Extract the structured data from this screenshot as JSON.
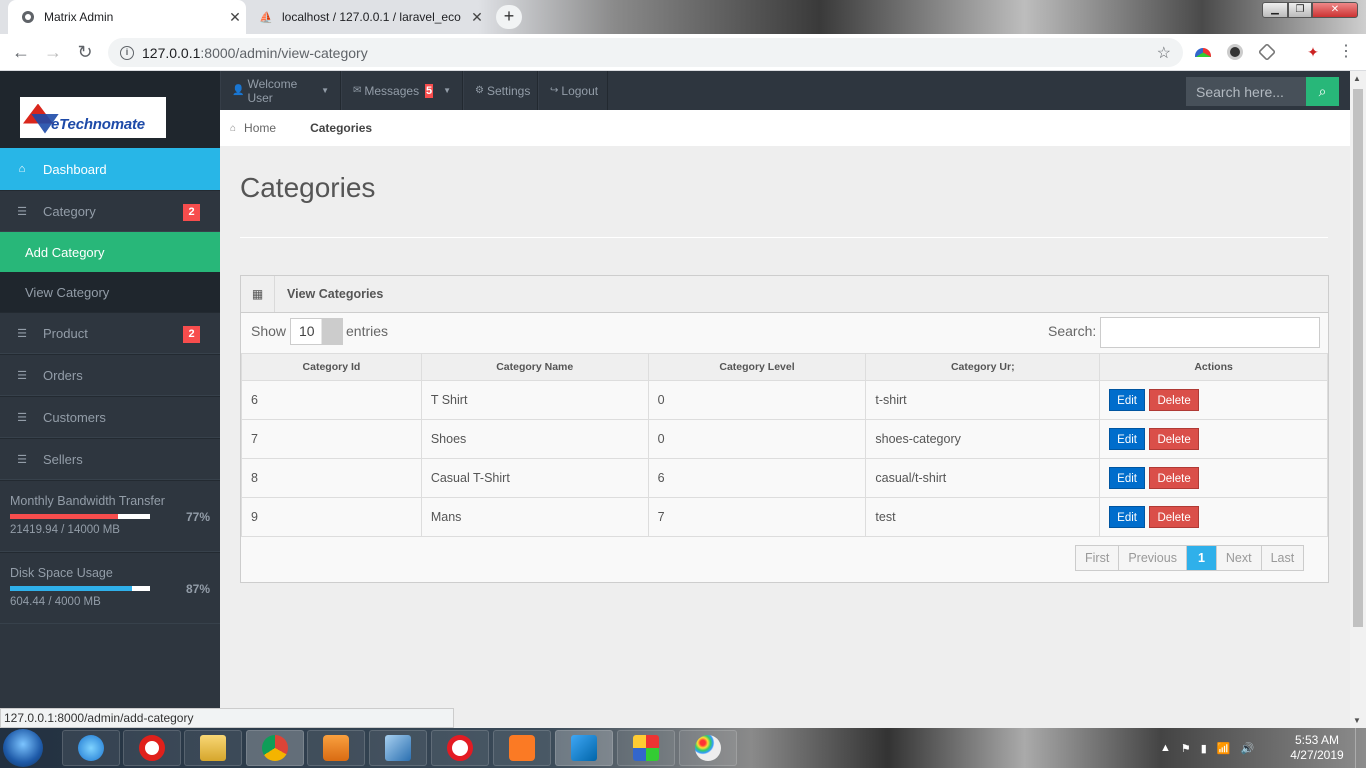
{
  "browser": {
    "tabs": [
      {
        "title": "Matrix Admin",
        "active": true
      },
      {
        "title": "localhost / 127.0.0.1 / laravel_eco",
        "active": false
      }
    ],
    "url_host": "127.0.0.1",
    "url_path": ":8000/admin/view-category",
    "status_url": "127.0.0.1:8000/admin/add-category"
  },
  "brand": {
    "logo_text": "eTechnomate"
  },
  "topnav": {
    "welcome": "Welcome User",
    "messages": "Messages",
    "messages_count": "5",
    "settings": "Settings",
    "logout": "Logout",
    "search_placeholder": "Search here..."
  },
  "sidebar": {
    "items": [
      {
        "label": "Dashboard",
        "icon": "home-icon",
        "active": true
      },
      {
        "label": "Category",
        "icon": "list-icon",
        "badge": "2"
      },
      {
        "label": "Add Category",
        "sub": true,
        "selected": true
      },
      {
        "label": "View Category",
        "sub": true
      },
      {
        "label": "Product",
        "icon": "list-icon",
        "badge": "2"
      },
      {
        "label": "Orders",
        "icon": "list-icon"
      },
      {
        "label": "Customers",
        "icon": "list-icon"
      },
      {
        "label": "Sellers",
        "icon": "list-icon"
      }
    ],
    "stats": [
      {
        "label": "Monthly Bandwidth Transfer",
        "usage": "21419.94 / 14000 MB",
        "percent": "77%",
        "fill": 0.77,
        "color": "#f74d4d"
      },
      {
        "label": "Disk Space Usage",
        "usage": "604.44 / 4000 MB",
        "percent": "87%",
        "fill": 0.87,
        "color": "#2fb0ea"
      }
    ]
  },
  "breadcrumb": {
    "home": "Home",
    "current": "Categories"
  },
  "page": {
    "title": "Categories"
  },
  "widget": {
    "title": "View Categories",
    "show_label": "Show",
    "entries_value": "10",
    "entries_label": "entries",
    "search_label": "Search:"
  },
  "table": {
    "headers": [
      "Category Id",
      "Category Name",
      "Category Level",
      "Category Ur;",
      "Actions"
    ],
    "rows": [
      {
        "id": "6",
        "name": "T Shirt",
        "level": "0",
        "url": "t-shirt"
      },
      {
        "id": "7",
        "name": "Shoes",
        "level": "0",
        "url": "shoes-category"
      },
      {
        "id": "8",
        "name": "Casual T-Shirt",
        "level": "6",
        "url": "casual/t-shirt"
      },
      {
        "id": "9",
        "name": "Mans",
        "level": "7",
        "url": "test"
      }
    ],
    "edit_label": "Edit",
    "delete_label": "Delete"
  },
  "pagination": {
    "first": "First",
    "previous": "Previous",
    "current": "1",
    "next": "Next",
    "last": "Last"
  },
  "taskbar": {
    "time": "5:53 AM",
    "date": "4/27/2019"
  },
  "colors": {
    "accent": "#28b6e7",
    "success": "#28b779",
    "danger": "#da4f49",
    "primary": "#006dcc"
  }
}
